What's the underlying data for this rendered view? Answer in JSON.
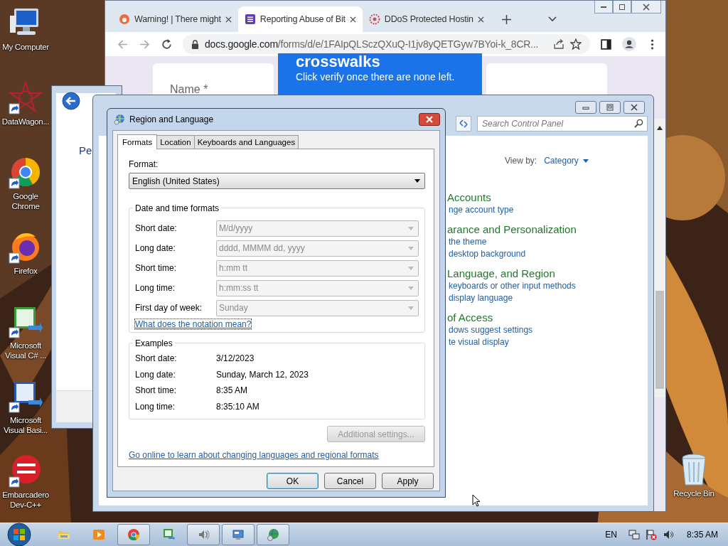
{
  "desktop": {
    "icons": [
      {
        "kind": "computer",
        "label": "My Computer",
        "shortcut": false
      },
      {
        "kind": "star",
        "label": "DataWagon...",
        "shortcut": true
      },
      {
        "kind": "chrome",
        "label": "Google Chrome",
        "shortcut": true
      },
      {
        "kind": "firefox",
        "label": "Firefox",
        "shortcut": true
      },
      {
        "kind": "csharp",
        "label": "Microsoft Visual C# ...",
        "shortcut": true
      },
      {
        "kind": "vb",
        "label": "Microsoft Visual Basi...",
        "shortcut": true
      },
      {
        "kind": "devcpp",
        "label": "Embarcadero Dev-C++",
        "shortcut": true
      }
    ],
    "recycle_bin": {
      "label": "Recycle Bin"
    }
  },
  "browser": {
    "tabs": [
      {
        "kind": "warning",
        "title": "Warning! | There might",
        "selected": false
      },
      {
        "kind": "form",
        "title": "Reporting Abuse of Bit",
        "selected": true
      },
      {
        "kind": "ddos",
        "title": "DDoS Protected Hostin",
        "selected": false
      }
    ],
    "address": {
      "host": "docs.google.com",
      "path": "/forms/d/e/1FAIpQLSczQXuQ-I1jv8yQETGyw7BYoi-k_8CR..."
    },
    "page": {
      "name_label": "Name *",
      "banner_title": "crosswalks",
      "banner_text": "Click verify once there are none left."
    }
  },
  "back_window": {
    "text": "Pe"
  },
  "control_panel": {
    "search_placeholder": "Search Control Panel",
    "view_by_label": "View by:",
    "view_by_value": "Category",
    "categories": [
      {
        "title": "Accounts",
        "links": [
          "nge account type"
        ]
      },
      {
        "title": "arance and Personalization",
        "links": [
          "the theme",
          "desktop background"
        ]
      },
      {
        "title": "Language, and Region",
        "links": [
          "keyboards or other input methods",
          "display language"
        ]
      },
      {
        "title": "of Access",
        "links": [
          "dows suggest settings",
          "te visual display"
        ]
      }
    ]
  },
  "dialog": {
    "title": "Region and Language",
    "tabs": [
      {
        "label": "Formats",
        "selected": true
      },
      {
        "label": "Location",
        "selected": false
      },
      {
        "label": "Keyboards and Languages",
        "selected": false
      }
    ],
    "format_label": "Format:",
    "format_value": "English (United States)",
    "formats_group": "Date and time formats",
    "formats": [
      {
        "label": "Short date:",
        "value": "M/d/yyyy",
        "disabled": true
      },
      {
        "label": "Long date:",
        "value": "dddd, MMMM dd, yyyy",
        "disabled": true
      },
      {
        "label": "Short time:",
        "value": "h:mm tt",
        "disabled": true
      },
      {
        "label": "Long time:",
        "value": "h:mm:ss tt",
        "disabled": true
      },
      {
        "label": "First day of week:",
        "value": "Sunday",
        "disabled": true
      }
    ],
    "notation_link": "What does the notation mean?",
    "examples_group": "Examples",
    "examples": [
      {
        "label": "Short date:",
        "value": "3/12/2023"
      },
      {
        "label": "Long date:",
        "value": "Sunday, March 12, 2023"
      },
      {
        "label": "Short time:",
        "value": "8:35 AM"
      },
      {
        "label": "Long time:",
        "value": "8:35:10 AM"
      }
    ],
    "additional_settings": {
      "label": "Additional settings...",
      "disabled": true
    },
    "online_link": "Go online to learn about changing languages and regional formats",
    "buttons": [
      {
        "label": "OK",
        "default": true
      },
      {
        "label": "Cancel",
        "default": false
      },
      {
        "label": "Apply",
        "default": false
      }
    ]
  },
  "taskbar": {
    "items": [
      {
        "kind": "folder",
        "running": false
      },
      {
        "kind": "media",
        "running": false
      },
      {
        "kind": "chrome",
        "running": true
      },
      {
        "kind": "csharp",
        "running": false
      },
      {
        "kind": "sound",
        "running": true
      },
      {
        "kind": "remote",
        "running": true
      },
      {
        "kind": "network",
        "running": true
      }
    ],
    "language": "EN",
    "clock": "8:35 AM"
  }
}
